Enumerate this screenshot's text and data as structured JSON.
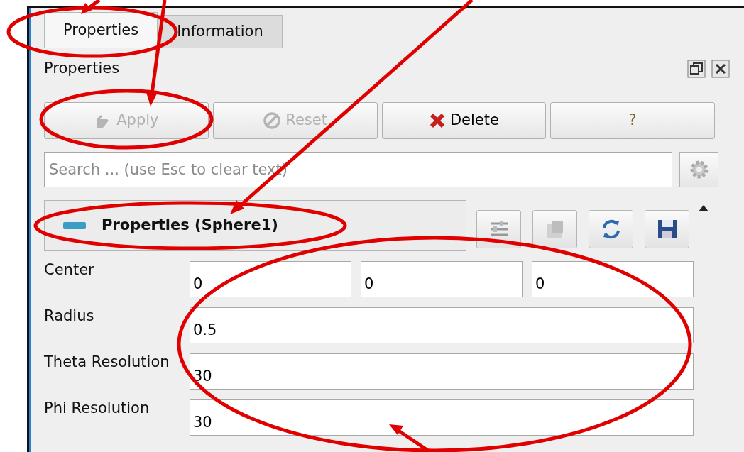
{
  "tabs": [
    {
      "label": "Properties",
      "selected": true
    },
    {
      "label": "Information",
      "selected": false
    }
  ],
  "panel": {
    "title": "Properties"
  },
  "buttons": [
    {
      "kind": "apply",
      "label": "Apply",
      "disabled": true
    },
    {
      "kind": "reset",
      "label": "Reset",
      "disabled": true
    },
    {
      "kind": "delete",
      "label": "Delete",
      "disabled": false
    },
    {
      "kind": "help",
      "label": "?",
      "disabled": false
    }
  ],
  "search": {
    "placeholder": "Search ... (use Esc to clear text)"
  },
  "section": {
    "title": "Properties (Sphere1)"
  },
  "properties": [
    {
      "label": "Center",
      "values": [
        "0",
        "0",
        "0"
      ]
    },
    {
      "label": "Radius",
      "values": [
        "0.5"
      ]
    },
    {
      "label": "Theta Resolution",
      "values": [
        "30"
      ]
    },
    {
      "label": "Phi Resolution",
      "values": [
        "30"
      ]
    }
  ]
}
